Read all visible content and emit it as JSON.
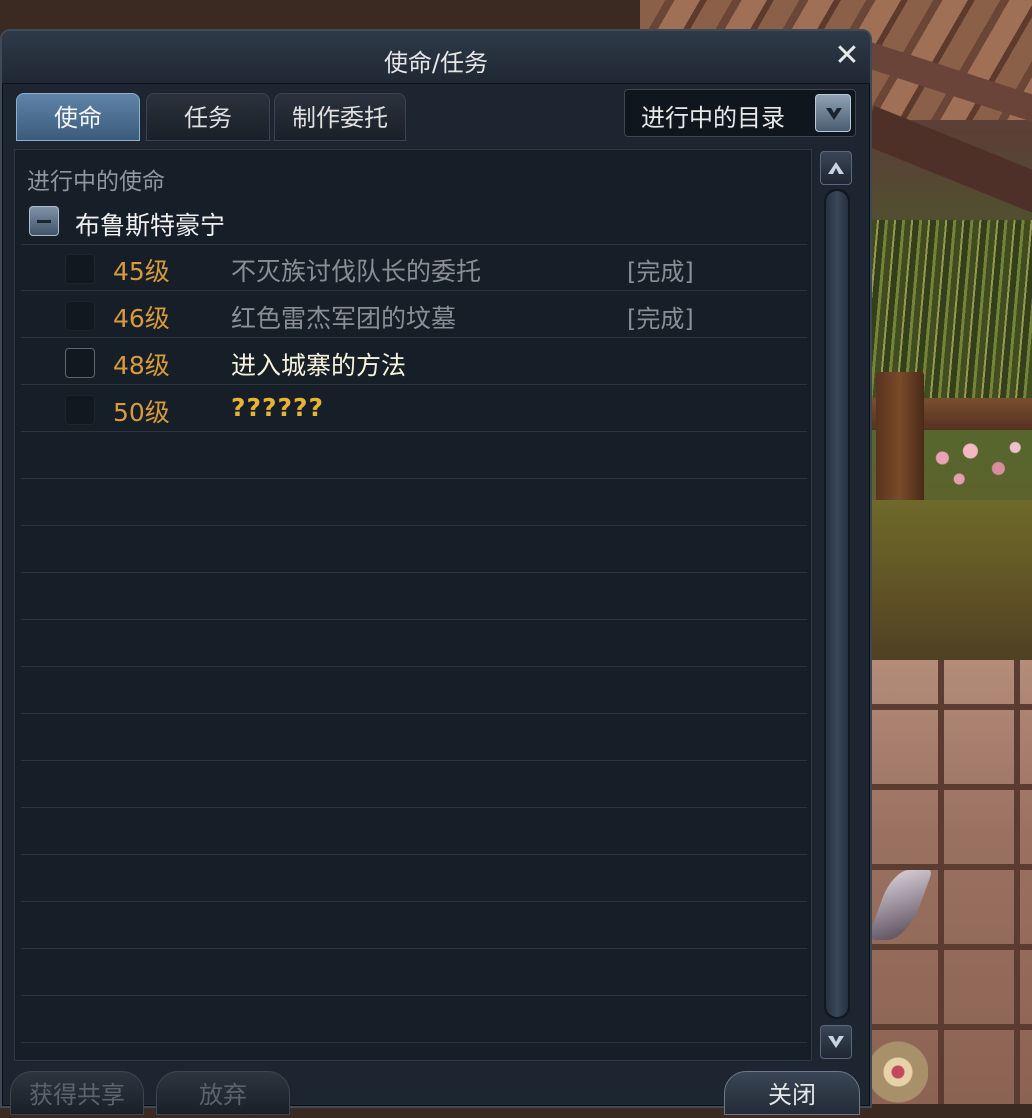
{
  "window": {
    "title": "使命/任务",
    "tabs": [
      {
        "label": "使命",
        "active": true
      },
      {
        "label": "任务",
        "active": false
      },
      {
        "label": "制作委托",
        "active": false
      }
    ],
    "filter": {
      "selected": "进行中的目录"
    }
  },
  "list": {
    "section_label": "进行中的使命",
    "group": {
      "name": "布鲁斯特豪宁",
      "expanded": true
    },
    "quests": [
      {
        "level": "45级",
        "name": "不灭族讨伐队长的委托",
        "status": "[完成]",
        "state": "completed"
      },
      {
        "level": "46级",
        "name": "红色雷杰军团的坟墓",
        "status": "[完成]",
        "state": "completed"
      },
      {
        "level": "48级",
        "name": "进入城寨的方法",
        "status": "",
        "state": "current"
      },
      {
        "level": "50级",
        "name": "??????",
        "status": "",
        "state": "unknown"
      }
    ]
  },
  "buttons": {
    "share": "获得共享",
    "abandon": "放弃",
    "close": "关闭"
  },
  "colors": {
    "level": "#d89a3c",
    "current_quest": "#f6f2dc",
    "unknown_quest": "#e6b23a",
    "completed_quest": "#8a8f96",
    "active_tab": "#4a6c90"
  }
}
